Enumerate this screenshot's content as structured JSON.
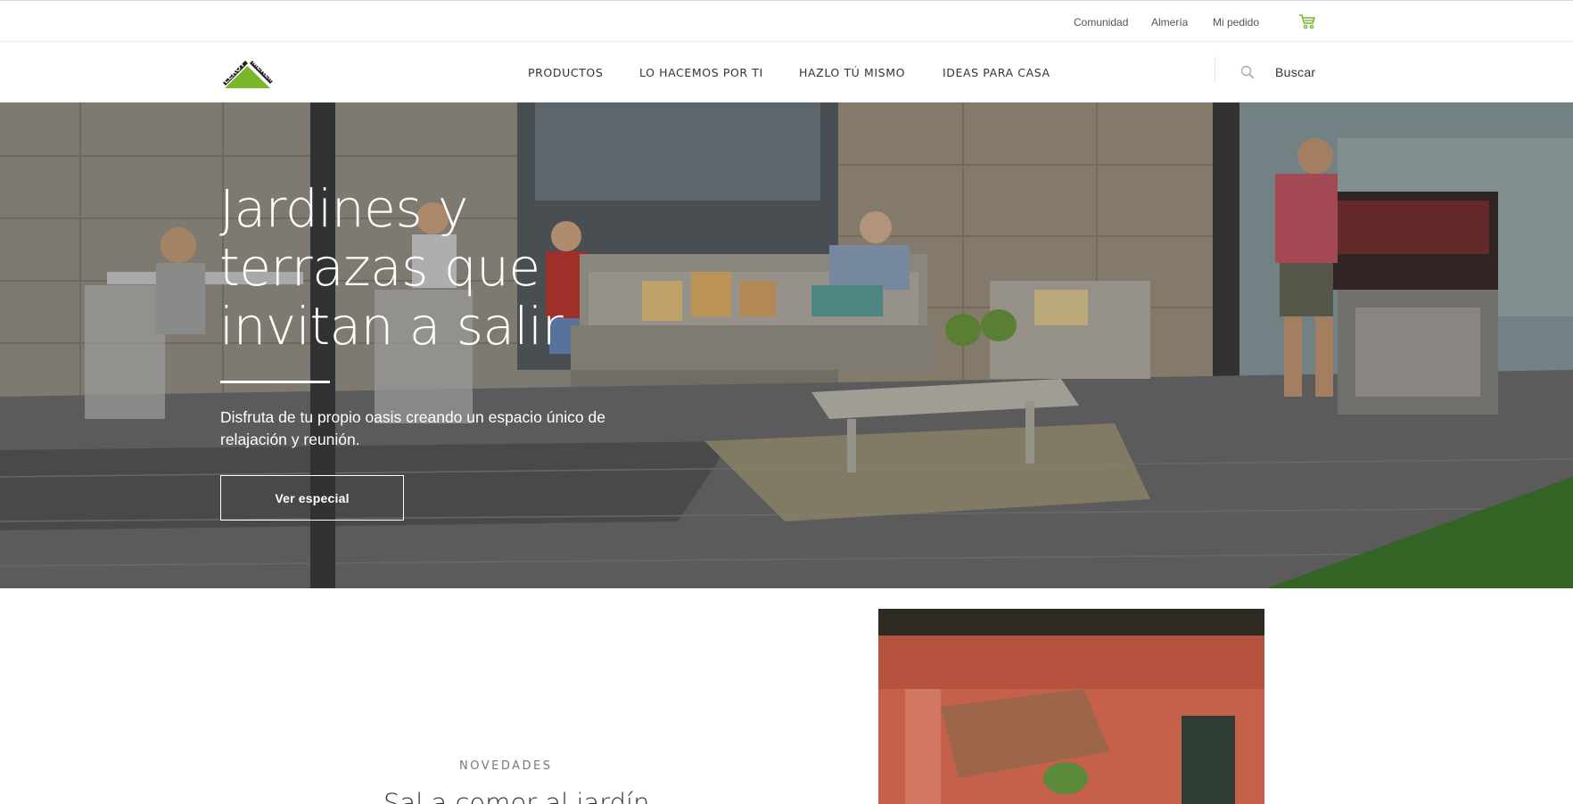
{
  "topbar": {
    "links": [
      "Comunidad",
      "Almería",
      "Mi pedido"
    ],
    "cart_icon": "cart-icon"
  },
  "header": {
    "logo_text_left": "LEROY",
    "logo_text_right": "MERLIN",
    "nav": [
      "PRODUCTOS",
      "LO HACEMOS POR TI",
      "HAZLO TÚ MISMO",
      "IDEAS PARA CASA"
    ],
    "search_label": "Buscar",
    "search_icon": "search-icon"
  },
  "hero": {
    "title_lines": [
      "Jardines y",
      "terrazas que",
      "invitan a salir"
    ],
    "subtitle": "Disfruta de tu propio oasis creando un espacio único de relajación y reunión.",
    "button": "Ver especial"
  },
  "section": {
    "tag": "NOVEDADES",
    "title": "Sal a comer al jardín"
  },
  "colors": {
    "brand_green": "#78b82a",
    "text_dark": "#333333"
  }
}
